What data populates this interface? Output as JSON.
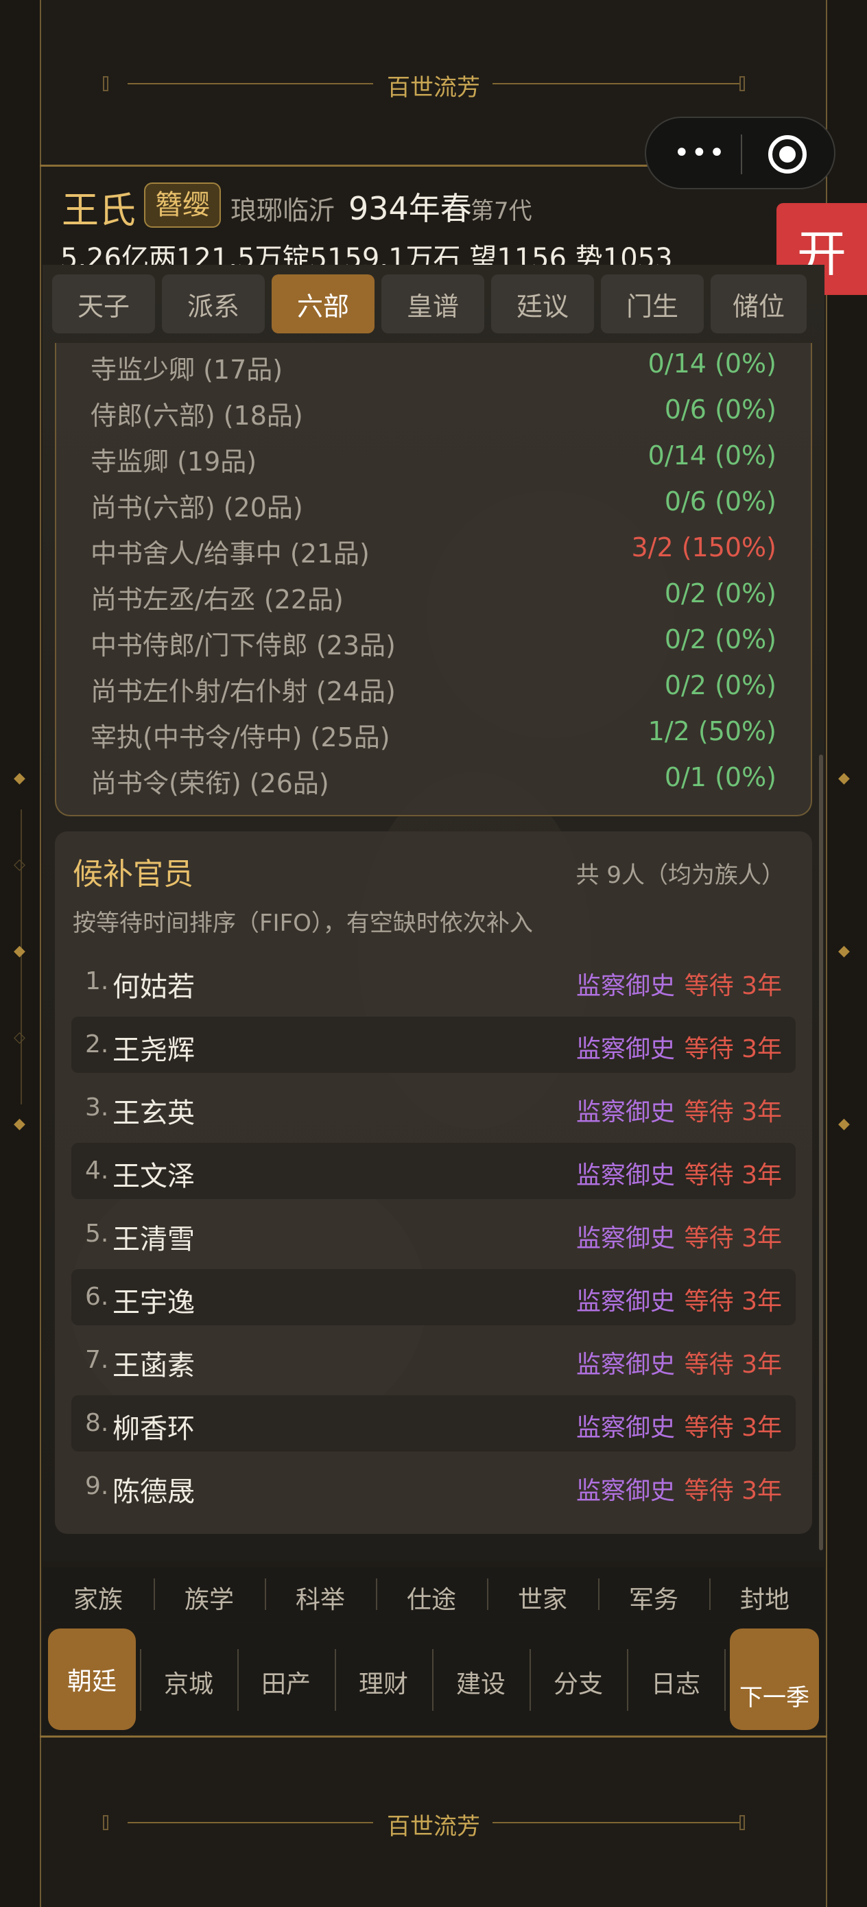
{
  "banner": {
    "title": "百世流芳"
  },
  "capsule": {
    "more_icon": "more-dots-icon",
    "close_icon": "target-icon"
  },
  "open_button": {
    "label": "开"
  },
  "header": {
    "clan": "王氏",
    "rank_badge": "簪缨",
    "origin": "琅琊临沂",
    "year": "934年春",
    "generation": "第7代",
    "wealth": "5.26亿两121.5万锭5159.1万石  望1156 势1053"
  },
  "tabs": [
    "天子",
    "派系",
    "六部",
    "皇谱",
    "廷议",
    "门生",
    "储位"
  ],
  "active_tab": "六部",
  "ranks": [
    {
      "label": "寺监少卿 (17品)",
      "value": "0/14 (0%)",
      "status": "ok"
    },
    {
      "label": "侍郎(六部) (18品)",
      "value": "0/6 (0%)",
      "status": "ok"
    },
    {
      "label": "寺监卿 (19品)",
      "value": "0/14 (0%)",
      "status": "ok"
    },
    {
      "label": "尚书(六部) (20品)",
      "value": "0/6 (0%)",
      "status": "ok"
    },
    {
      "label": "中书舍人/给事中 (21品)",
      "value": "3/2 (150%)",
      "status": "over"
    },
    {
      "label": "尚书左丞/右丞 (22品)",
      "value": "0/2 (0%)",
      "status": "ok"
    },
    {
      "label": "中书侍郎/门下侍郎 (23品)",
      "value": "0/2 (0%)",
      "status": "ok"
    },
    {
      "label": "尚书左仆射/右仆射 (24品)",
      "value": "0/2 (0%)",
      "status": "ok"
    },
    {
      "label": "宰执(中书令/侍中) (25品)",
      "value": "1/2 (50%)",
      "status": "ok"
    },
    {
      "label": "尚书令(荣衔) (26品)",
      "value": "0/1 (0%)",
      "status": "ok"
    }
  ],
  "candidates": {
    "title": "候补官员",
    "count": "共 9人（均为族人）",
    "desc": "按等待时间排序（FIFO），有空缺时依次补入",
    "list": [
      {
        "num": "1.",
        "name": "何姑若",
        "position": "监察御史",
        "wait": "等待 3年"
      },
      {
        "num": "2.",
        "name": "王尧辉",
        "position": "监察御史",
        "wait": "等待 3年"
      },
      {
        "num": "3.",
        "name": "王玄英",
        "position": "监察御史",
        "wait": "等待 3年"
      },
      {
        "num": "4.",
        "name": "王文泽",
        "position": "监察御史",
        "wait": "等待 3年"
      },
      {
        "num": "5.",
        "name": "王清雪",
        "position": "监察御史",
        "wait": "等待 3年"
      },
      {
        "num": "6.",
        "name": "王宇逸",
        "position": "监察御史",
        "wait": "等待 3年"
      },
      {
        "num": "7.",
        "name": "王菡素",
        "position": "监察御史",
        "wait": "等待 3年"
      },
      {
        "num": "8.",
        "name": "柳香环",
        "position": "监察御史",
        "wait": "等待 3年"
      },
      {
        "num": "9.",
        "name": "陈德晟",
        "position": "监察御史",
        "wait": "等待 3年"
      }
    ]
  },
  "nav_top": [
    "家族",
    "族学",
    "科举",
    "仕途",
    "世家",
    "军务",
    "封地"
  ],
  "nav_bottom": [
    "朝廷",
    "京城",
    "田产",
    "理财",
    "建设",
    "分支",
    "日志"
  ],
  "next_button": "下一季",
  "colors": {
    "accent": "#9a6a2c",
    "gold": "#e8c06b",
    "ok": "#6fc277",
    "over": "#e0584a",
    "position": "#b071e0"
  }
}
